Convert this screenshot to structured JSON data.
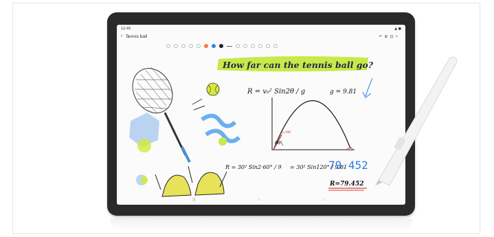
{
  "status_bar": {
    "time": "12:45",
    "indicators": "▲ ●"
  },
  "note": {
    "title": "Tennis ball"
  },
  "header_icons": [
    "undo-icon",
    "search-icon",
    "settings-icon",
    "more-icon"
  ],
  "handwriting": {
    "question": "How far can the tennis ball go?",
    "formula_top": "R = v₀² Sin2θ / g",
    "gravity": "g = 9.81",
    "velocity_label": "v₀=30",
    "angle_label": "60°",
    "formula_left": "R = 30² Sin2·60° / 9",
    "formula_mid": "= 30² Sin120° / 9.81",
    "result_blue": "79.452",
    "result_boxed": "R=79.452"
  },
  "colors": {
    "highlight": "#c9e84a",
    "blue_ink": "#2f7be0",
    "red_ink": "#d84040",
    "tablet_frame": "#2a2a2a"
  }
}
